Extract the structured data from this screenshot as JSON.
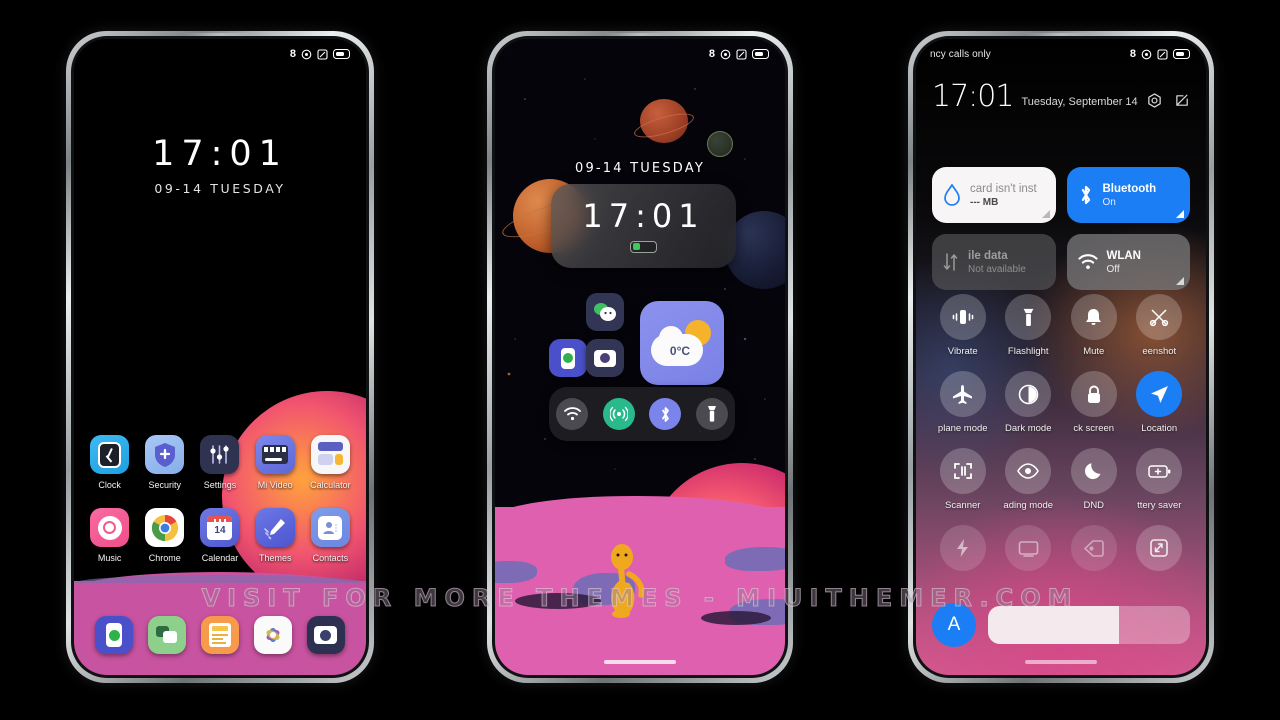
{
  "watermark": "VISIT FOR MORE THEMES - MIUITHEMER.COM",
  "colors": {
    "accent_blue": "#1b7ef5",
    "bluetooth_tile": "#1b7ef5",
    "weather_widget": "#8b92ed",
    "ground_pink": "#e060b0",
    "dock_pink": "#c853a0"
  },
  "phone1": {
    "name": "lock-screen",
    "statusbar": {
      "left_text": "",
      "icons": [
        "signal-8-icon",
        "alarm-icon",
        "sim-icon",
        "battery-icon"
      ]
    },
    "clock": {
      "time": "17:01",
      "date": "09-14 TUESDAY"
    },
    "apps_row1": [
      {
        "label": "Clock",
        "icon": "clock-icon"
      },
      {
        "label": "Security",
        "icon": "shield-icon"
      },
      {
        "label": "Settings",
        "icon": "sliders-icon"
      },
      {
        "label": "Mi Video",
        "icon": "film-icon"
      },
      {
        "label": "Calculator",
        "icon": "calculator-icon"
      }
    ],
    "apps_row2": [
      {
        "label": "Music",
        "icon": "music-disc-icon"
      },
      {
        "label": "Chrome",
        "icon": "chrome-icon"
      },
      {
        "label": "Calendar",
        "icon": "calendar-icon",
        "day": "14"
      },
      {
        "label": "Themes",
        "icon": "brush-icon"
      },
      {
        "label": "Contacts",
        "icon": "contact-card-icon"
      }
    ],
    "dock": [
      {
        "label": "Phone",
        "icon": "phone-icon"
      },
      {
        "label": "Messages",
        "icon": "message-bubbles-icon"
      },
      {
        "label": "Notes",
        "icon": "notes-icon"
      },
      {
        "label": "Gallery",
        "icon": "gallery-flower-icon"
      },
      {
        "label": "Camera",
        "icon": "camera-icon"
      }
    ]
  },
  "phone2": {
    "name": "home-screen",
    "statusbar": {
      "left_text": "",
      "icons": [
        "signal-8-icon",
        "alarm-icon",
        "sim-icon",
        "battery-icon"
      ]
    },
    "date": "09-14 TUESDAY",
    "clock_widget": {
      "time": "17:01",
      "battery_level_pct": 30
    },
    "small_widgets": [
      {
        "label": "WeChat",
        "icon": "wechat-icon"
      },
      {
        "label": "Phone",
        "icon": "phone-icon"
      },
      {
        "label": "Camera",
        "icon": "camera-icon"
      }
    ],
    "weather_widget": {
      "temperature": "0°C",
      "icon": "sun-behind-cloud-icon"
    },
    "toggles": [
      {
        "label": "Wi-Fi",
        "icon": "wifi-icon",
        "active": false
      },
      {
        "label": "Hotspot",
        "icon": "hotspot-icon",
        "active": true
      },
      {
        "label": "Bluetooth",
        "icon": "bluetooth-icon",
        "active": true
      },
      {
        "label": "Flashlight",
        "icon": "flashlight-icon",
        "active": false
      }
    ]
  },
  "phone3": {
    "name": "control-center",
    "statusbar": {
      "left_text": "ncy calls only",
      "icons": [
        "signal-8-icon",
        "alarm-icon",
        "sim-icon",
        "battery-icon"
      ]
    },
    "header": {
      "time": "17:01",
      "date": "Tuesday, September 14",
      "icons": [
        "settings-gear-icon",
        "edit-icon"
      ]
    },
    "tiles": [
      {
        "t1": "card isn't inst",
        "t2": "--- MB",
        "icon": "data-drop-icon",
        "state": "light"
      },
      {
        "t1": "Bluetooth",
        "t2": "On",
        "icon": "bluetooth-icon",
        "state": "on"
      },
      {
        "t1": "ile data",
        "t2": "Not available",
        "icon": "data-arrows-icon",
        "state": "disabled"
      },
      {
        "t1": "WLAN",
        "t2": "Off",
        "icon": "wifi-icon",
        "state": "off"
      }
    ],
    "circles": [
      {
        "label": "Vibrate",
        "icon": "vibrate-icon",
        "active": false,
        "dim": false
      },
      {
        "label": "Flashlight",
        "icon": "flashlight-icon",
        "active": false,
        "dim": false
      },
      {
        "label": "Mute",
        "icon": "bell-icon",
        "active": false,
        "dim": false
      },
      {
        "label": "eenshot",
        "icon": "screenshot-icon",
        "active": false,
        "dim": false
      },
      {
        "label": "plane mode",
        "icon": "airplane-icon",
        "active": false,
        "dim": false
      },
      {
        "label": "Dark mode",
        "icon": "contrast-icon",
        "active": false,
        "dim": false
      },
      {
        "label": "ck screen",
        "icon": "lock-icon",
        "active": false,
        "dim": false
      },
      {
        "label": "Location",
        "icon": "location-arrow-icon",
        "active": true,
        "dim": false
      },
      {
        "label": "Scanner",
        "icon": "scan-frame-icon",
        "active": false,
        "dim": false
      },
      {
        "label": "ading mode",
        "icon": "eye-icon",
        "active": false,
        "dim": false
      },
      {
        "label": "DND",
        "icon": "moon-icon",
        "active": false,
        "dim": false
      },
      {
        "label": "ttery saver",
        "icon": "battery-plus-icon",
        "active": false,
        "dim": false
      },
      {
        "label": "",
        "icon": "lightning-icon",
        "active": false,
        "dim": true
      },
      {
        "label": "",
        "icon": "cast-screen-icon",
        "active": false,
        "dim": true
      },
      {
        "label": "",
        "icon": "nfc-tag-icon",
        "active": false,
        "dim": true
      },
      {
        "label": "",
        "icon": "expand-arrows-icon",
        "active": false,
        "dim": true
      }
    ],
    "brightness": {
      "auto_label": "A",
      "value_pct": 65
    }
  }
}
